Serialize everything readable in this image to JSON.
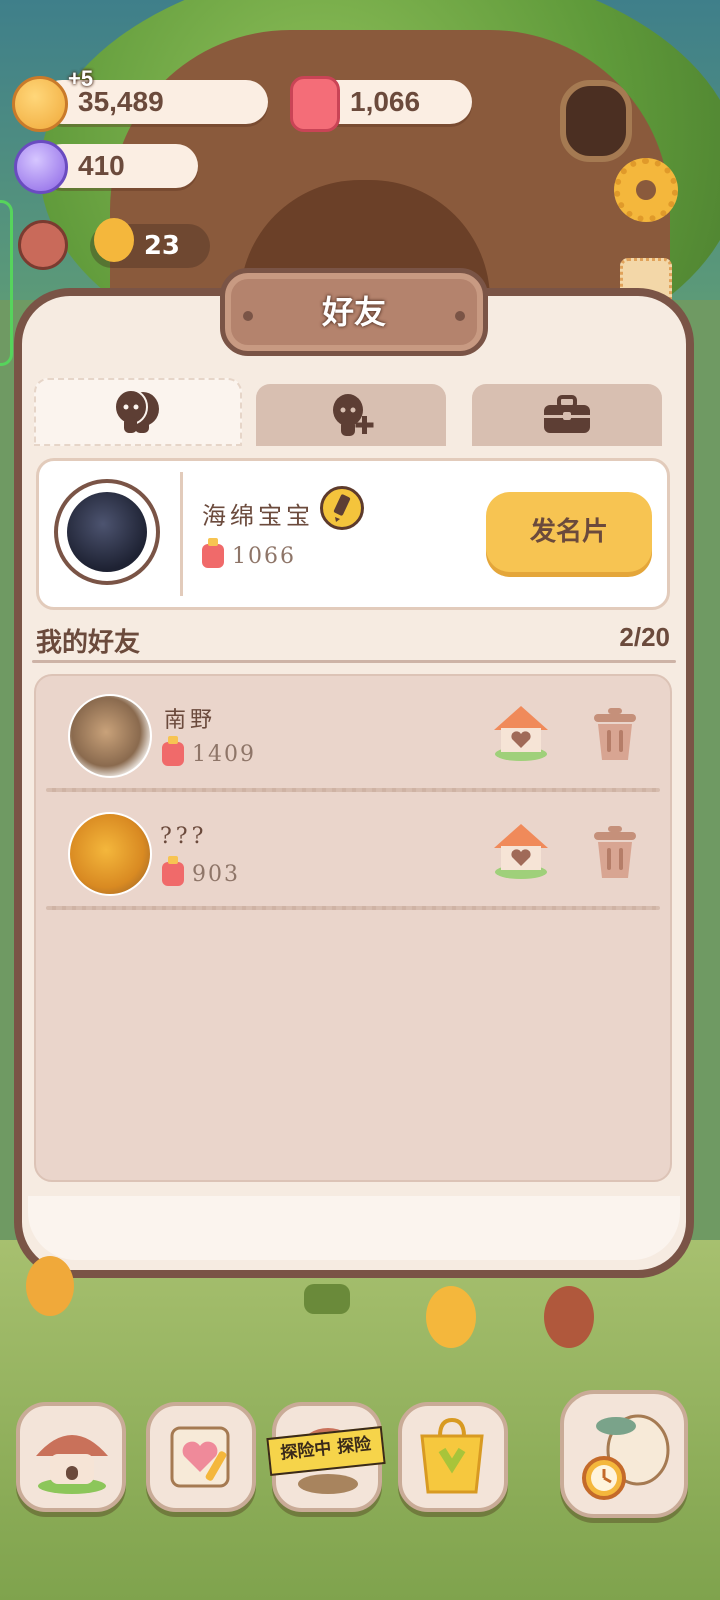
{
  "resources": {
    "cookie_bonus": "+5",
    "cookie_amount": "35,489",
    "candy_amount": "1,066",
    "crystal_amount": "410",
    "side_count": "23"
  },
  "panel": {
    "title": "好友"
  },
  "tabs": [
    {
      "icon": "friends-icon",
      "active": true
    },
    {
      "icon": "add-friend-icon",
      "active": false
    },
    {
      "icon": "briefcase-icon",
      "active": false
    }
  ],
  "profile": {
    "name": "海绵宝宝",
    "score": "1066",
    "send_card_label": "发名片"
  },
  "friends_section": {
    "title": "我的好友",
    "count": "2/20"
  },
  "friends": [
    {
      "name": "南野",
      "score": "1409"
    },
    {
      "name": "???",
      "score": "903"
    }
  ],
  "bottom_nav": {
    "explore_tape": "探险中 探险"
  },
  "colors": {
    "panel_border": "#7a5446",
    "panel_bg": "#f6ebe1",
    "button_yellow": "#f7c452",
    "text_brown": "#6b4a3c"
  }
}
